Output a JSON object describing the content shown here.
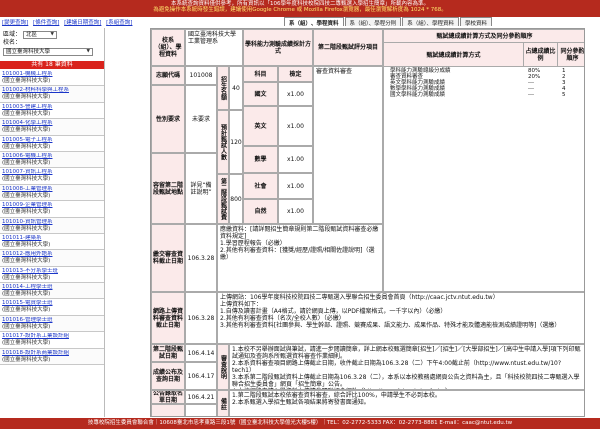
{
  "notice": {
    "line1": "本系統查詢資料僅供參考，所有資訊以「106學年度科技校院四技二專甄選入學招生簡章」所載內容為準。",
    "line2": "為避免操作本系統時發生錯誤，建議使用Google Chrome 或 Mozilla Firefox瀏覽器，最佳瀏覽解析度為 1024 * 768。"
  },
  "left_nav": [
    "[變更查詢]",
    "[條件查詢]",
    "[建議日期查詢]",
    "[系組查詢]"
  ],
  "tabs": [
    "系（組）、學程資料",
    "系（組）、學程分則",
    "系（組）、學程資料",
    "學校資料"
  ],
  "filters": {
    "region_label": "區域：",
    "region_value": "北區",
    "school_label": "校名：",
    "school_value": "國立臺灣科技大學"
  },
  "count_label": "共有 18 筆資料",
  "departments": [
    {
      "name": "101001-機械工程系",
      "school": "(國立臺灣科技大學)"
    },
    {
      "name": "101002-材料科學與工程系",
      "school": "(國立臺灣科技大學)"
    },
    {
      "name": "101003-營建工程系",
      "school": "(國立臺灣科技大學)"
    },
    {
      "name": "101004-化學工程系",
      "school": "(國立臺灣科技大學)"
    },
    {
      "name": "101005-電子工程系",
      "school": "(國立臺灣科技大學)"
    },
    {
      "name": "101006-電機工程系",
      "school": "(國立臺灣科技大學)"
    },
    {
      "name": "101007-資訊工程系",
      "school": "(國立臺灣科技大學)"
    },
    {
      "name": "101008-工業管理系",
      "school": "(國立臺灣科技大學)"
    },
    {
      "name": "101009-企業管理系",
      "school": "(國立臺灣科技大學)"
    },
    {
      "name": "101010-資訊管理系",
      "school": "(國立臺灣科技大學)"
    },
    {
      "name": "101011-建築系",
      "school": "(國立臺灣科技大學)"
    },
    {
      "name": "101012-應用外語系",
      "school": "(國立臺灣科技大學)"
    },
    {
      "name": "101013-不分系學士班",
      "school": "(國立臺灣科技大學)"
    },
    {
      "name": "101014-工程學士班",
      "school": "(國立臺灣科技大學)"
    },
    {
      "name": "101015-電資學士班",
      "school": "(國立臺灣科技大學)"
    },
    {
      "name": "101016-管理學士班",
      "school": "(國立臺灣科技大學)"
    },
    {
      "name": "101017-設計系工業設計組",
      "school": "(國立臺灣科技大學)"
    },
    {
      "name": "101018-設計系商業設計組",
      "school": "(國立臺灣科技大學)"
    }
  ],
  "table": {
    "h_school": "校系（組）、學程資料",
    "school_text": "國立臺灣科技大學\n工業管理系",
    "h_ability": "學科能力測驗成績採計方式",
    "h_stage2": "第二階段甄試評分項目",
    "code_label": "志願代碼",
    "code_value": "101008",
    "quota_label": "招生名額",
    "quota_value": "40",
    "subj_col": "科目",
    "weight_col": "檢定",
    "subjects": [
      {
        "name": "國文",
        "weight": "x1.00"
      },
      {
        "name": "英文",
        "weight": "x1.00"
      },
      {
        "name": "數學",
        "weight": "x1.00"
      },
      {
        "name": "社會",
        "weight": "x1.00"
      },
      {
        "name": "自然",
        "weight": "x1.00"
      }
    ],
    "gender_label": "性別要求",
    "gender_value": "未要求",
    "screen_label": "預計甄試人數",
    "screen_value": "120",
    "extra_label": "容留第二階段甄試地點",
    "extra_value": "詳見“備註說明”",
    "stage2_label": "第二階段甄試費",
    "stage2_value": "800",
    "stage2_item": "審查資料審查",
    "rb_title": "甄試總成績計算方式及同分參酌順序",
    "rb_col1": "甄試總成績計算方式",
    "rb_col2": "占總成績比例",
    "rb_col3": "同分參酌順序",
    "rb_items": [
      "學科能力測驗總級分成績",
      "審查資料審查",
      "英文學科能力測驗成績",
      "數學學科能力測驗成績",
      "國文學科能力測驗成績"
    ],
    "rb_ratio": [
      "80%",
      "20%",
      "---",
      "---",
      "---"
    ],
    "rb_order": [
      "1",
      "2",
      "3",
      "4",
      "5"
    ],
    "r_review_label": "繳交審查資料截止日期",
    "r_review_date": "106.3.28",
    "r_review_text": "應繳資料：[請詳閱招生簡章規則第二階段甄試資料審查必繳資料規定]\n1.學習歷程報告（必繳）\n2.其他有利審查資料：[獲獎/經歷/證照/相關佐證說明]（選繳）",
    "r_upload_label": "網路上傳資料審查資料截止日期",
    "r_upload_date": "106.3.28",
    "r_upload_text": "上傳網站：106學年度科技校院四技二專甄選入學聯合招生委員會首頁（http://caac.jctv.ntut.edu.tw）\n上傳資料如下：\n1.自傳及讀書計畫（A4格式，請於網頁上傳，以PDF檔案格式，一千字以內）（必繳）\n2.其他有利審查資料（名次/全校人數）（必繳）\n3.其他有利審查資料[社團參與、學生幹部、證照、競賽成果、語文能力、成果作品、特殊才能及體適能檢測成績證明等]（選繳）",
    "r_list_label": "第二階段甄試日期",
    "r_list_date": "106.4.14",
    "r_result_label": "成績公布及查詢日期",
    "r_result_date": "106.4.17",
    "r_review_label2": "審查說明",
    "r_review_text2": "1.本校不另舉辦面試與筆試，請進一步閱讀簡章，詳上網本校甄選簡章[招生]／[招生]／[大學部招生]／[高中生申請入學]項下列印甄試通知及查詢系所甄選資料審查作業細則。\n2.本系資料審查項目網路上傳截止日期，收件截止日期為106.3.28（二）下午4:00截止前（http://www.ntust.edu.tw/10?tech1）\n3.本系第二階段甄試資料上傳截止日期為106.3.28（二），本系以本校教務處網頁公告之資料為主，且「科技校院四技二專甄選入學聯合招生委員會」網頁「招生簡章」公告。\n4.本校網路申請入學資料上傳請參閱聯招會網站（http://caac.jctv.ntut.edu.tw）。",
    "r_announce_label": "公告錄取名單日期",
    "r_announce_date": "106.4.21",
    "r_note_label": "備註",
    "r_note_text": "1.第二階段甄試本校依審查資料審查，綜合評比100%，申請學生不必到本校。\n2.本系甄選入學招生甄試各項結果將寄發書面通知。"
  },
  "footer_text": "技專校院招生委員會聯合會｜10608臺北市忠孝東路三段1號（國立臺北科技大學億光大樓5樓）｜TEL：02-2772-5333 FAX：02-2773-8881 E-mail：caac@ntut.edu.tw"
}
